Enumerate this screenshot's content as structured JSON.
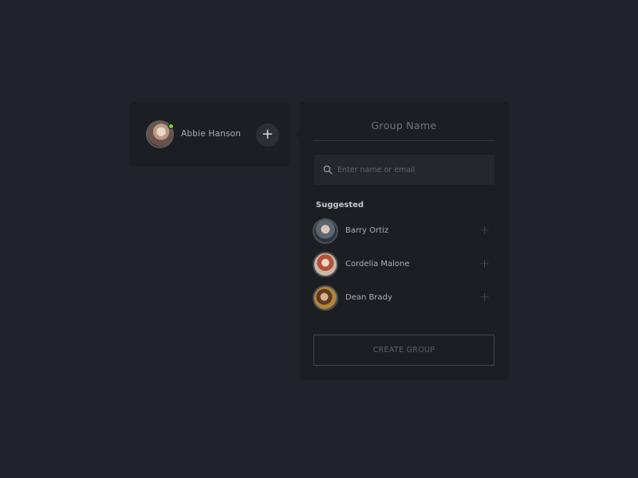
{
  "user_card": {
    "name": "Abbie Hanson",
    "status": "online",
    "status_color": "#7ed321",
    "add_icon": "plus-icon"
  },
  "group_panel": {
    "group_name_placeholder": "Group Name",
    "search": {
      "icon": "search-icon",
      "placeholder": "Enter name or email",
      "value": ""
    },
    "suggested_label": "Suggested",
    "suggested": [
      {
        "name": "Barry Ortiz",
        "action_icon": "plus-icon"
      },
      {
        "name": "Cordelia Malone",
        "action_icon": "plus-icon"
      },
      {
        "name": "Dean Brady",
        "action_icon": "plus-icon"
      }
    ],
    "create_button_label": "CREATE GROUP"
  }
}
